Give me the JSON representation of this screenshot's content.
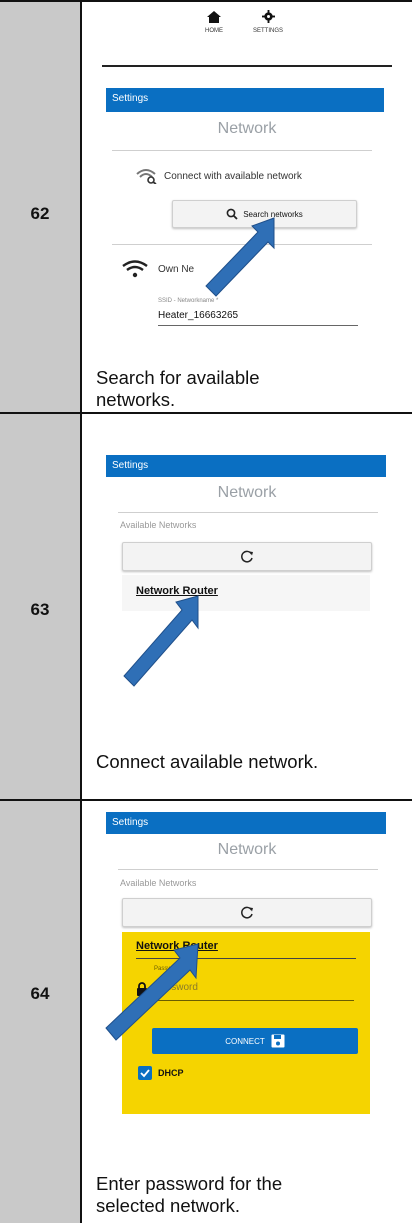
{
  "rows": [
    {
      "step": "62",
      "caption_line1": "Search for available",
      "caption_line2": "networks.",
      "nav": {
        "home_label": "HOME",
        "settings_label": "SETTINGS"
      },
      "header": "Settings",
      "title": "Network",
      "connect_label": "Connect with available network",
      "search_button": "Search networks",
      "own_network_label": "Own Ne",
      "ssid_label": "SSID - Networkname *",
      "ssid_value": "Heater_16663265"
    },
    {
      "step": "63",
      "caption": "Connect available network.",
      "header": "Settings",
      "title": "Network",
      "available_label": "Available Networks",
      "network_name": "Network Router"
    },
    {
      "step": "64",
      "caption_line1": "Enter password for the",
      "caption_line2": "selected network.",
      "header": "Settings",
      "title": "Network",
      "available_label": "Available Networks",
      "network_name": "Network Router",
      "password_label": "Password *",
      "password_placeholder": "Password",
      "connect_button": "CONNECT",
      "dhcp_label": "DHCP"
    }
  ],
  "colors": {
    "header_blue": "#0a6fc2",
    "highlight_yellow": "#f5d400",
    "arrow_blue": "#2f6fb6"
  }
}
